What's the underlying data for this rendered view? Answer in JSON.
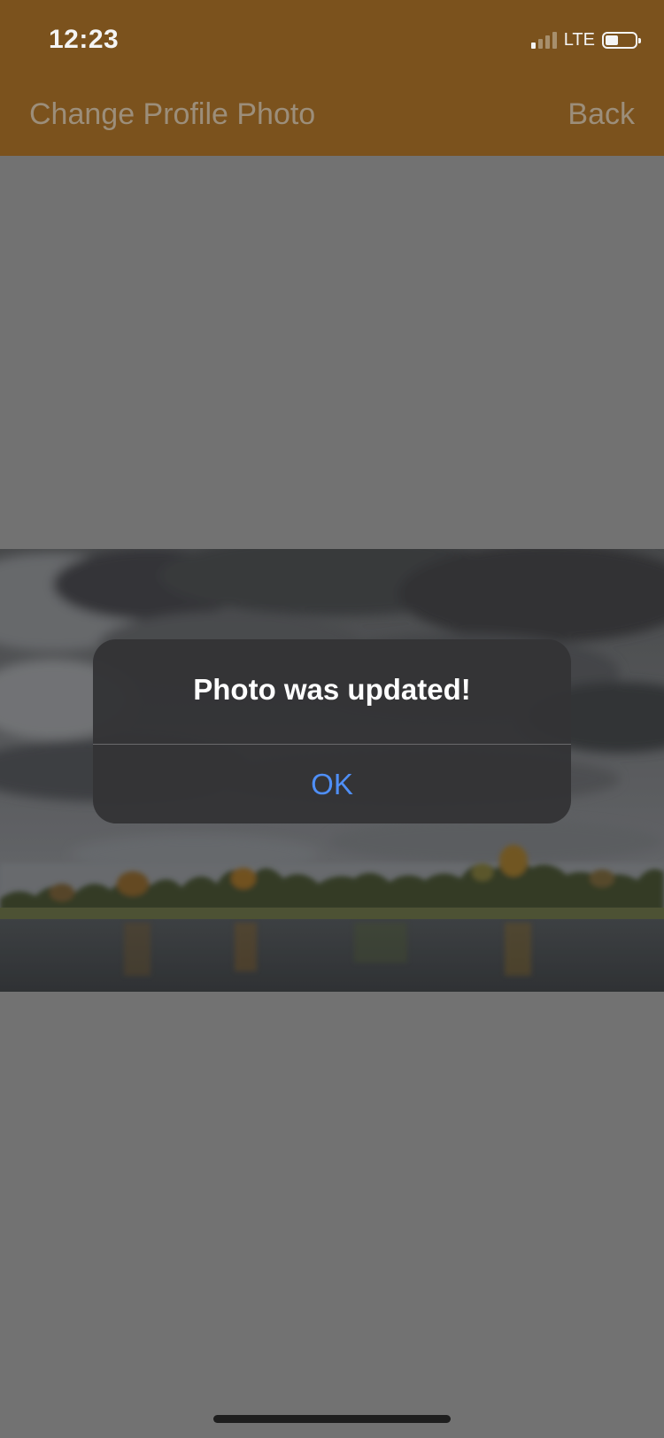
{
  "status_bar": {
    "time": "12:23",
    "network": "LTE",
    "signal_bars_active": 1,
    "signal_bars_total": 4,
    "battery_level": 0.44
  },
  "nav_bar": {
    "title": "Change Profile Photo",
    "back_label": "Back"
  },
  "photo": {
    "description_icon": "landscape-photo"
  },
  "alert": {
    "title": "Photo was updated!",
    "ok_label": "OK"
  },
  "colors": {
    "header_bg": "#7b521d",
    "screen_bg": "#8b8b8b",
    "alert_bg": "#343436",
    "alert_button": "#4f8ff7"
  }
}
